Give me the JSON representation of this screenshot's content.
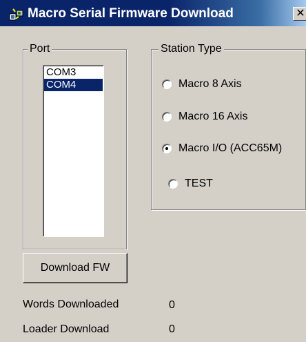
{
  "window": {
    "title": "Macro Serial Firmware Download",
    "close_glyph": "✕",
    "icon": "app-icon"
  },
  "port": {
    "label": "Port",
    "items": [
      {
        "label": "COM3",
        "selected": false
      },
      {
        "label": "COM4",
        "selected": true
      }
    ]
  },
  "station": {
    "label": "Station Type",
    "options": [
      {
        "label": "Macro 8 Axis",
        "checked": false
      },
      {
        "label": "Macro 16 Axis",
        "checked": false
      },
      {
        "label": "Macro I/O (ACC65M)",
        "checked": true
      },
      {
        "label": "TEST",
        "checked": false
      }
    ]
  },
  "actions": {
    "download_label": "Download FW"
  },
  "status": {
    "words_label": "Words Downloaded",
    "words_value": "0",
    "loader_label": "Loader Download",
    "loader_value": "0"
  },
  "colors": {
    "title_bg": "#0a246a",
    "selection": "#0a246a",
    "face": "#d4d0c8"
  }
}
